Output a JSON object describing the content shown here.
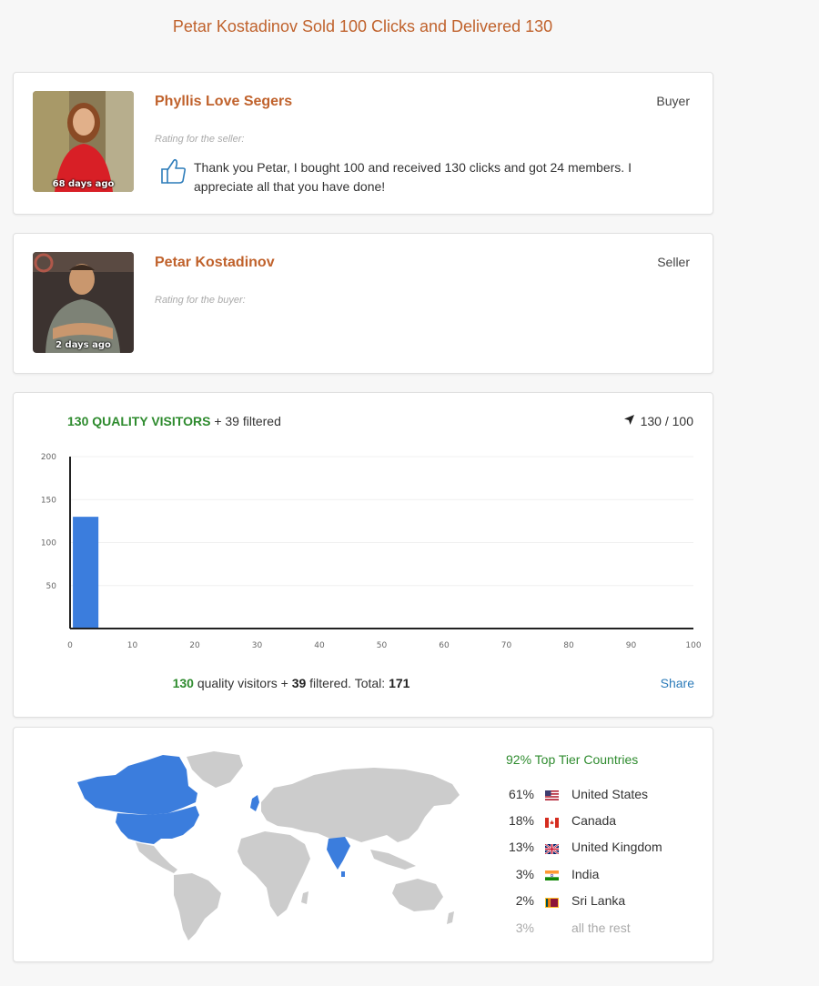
{
  "page": {
    "title": "Petar Kostadinov Sold 100 Clicks and Delivered 130"
  },
  "buyer_review": {
    "name": "Phyllis Love Segers",
    "role": "Buyer",
    "age": "68 days ago",
    "rating_label": "Rating for the seller:",
    "rating_icon": "thumbs-up-icon",
    "comment": "Thank you Petar, I bought 100 and received 130 clicks and got 24 members. I appreciate all that you have done!"
  },
  "seller_review": {
    "name": "Petar Kostadinov",
    "role": "Seller",
    "age": "2 days ago",
    "rating_label": "Rating for the buyer:"
  },
  "visitors": {
    "quality_label": "130 QUALITY VISITORS",
    "filtered_label": "+ 39 filtered",
    "count_icon": "navigation-arrow-icon",
    "count": "130 / 100",
    "summary": {
      "quality": "130",
      "quality_text": "quality visitors +",
      "filtered": "39",
      "filtered_text": "filtered. Total:",
      "total": "171"
    },
    "share_label": "Share"
  },
  "chart_data": {
    "type": "bar",
    "x": [
      2.5
    ],
    "values": [
      130
    ],
    "xlim": [
      0,
      100
    ],
    "ylim": [
      0,
      200
    ],
    "x_ticks": [
      0,
      10,
      20,
      30,
      40,
      50,
      60,
      70,
      80,
      90,
      100
    ],
    "y_ticks": [
      50,
      100,
      150,
      200
    ],
    "bar_color": "#3b7ddd",
    "grid": true
  },
  "geo": {
    "top_tier_label": "92% Top Tier Countries",
    "highlight_color": "#3b7ddd",
    "base_color": "#cccccc",
    "countries": [
      {
        "pct": "61%",
        "name": "United States",
        "flag": "us-flag-icon"
      },
      {
        "pct": "18%",
        "name": "Canada",
        "flag": "canada-flag-icon"
      },
      {
        "pct": "13%",
        "name": "United Kingdom",
        "flag": "uk-flag-icon"
      },
      {
        "pct": "3%",
        "name": "India",
        "flag": "india-flag-icon"
      },
      {
        "pct": "2%",
        "name": "Sri Lanka",
        "flag": "sri-lanka-flag-icon"
      }
    ],
    "rest": {
      "pct": "3%",
      "name": "all the rest"
    }
  }
}
